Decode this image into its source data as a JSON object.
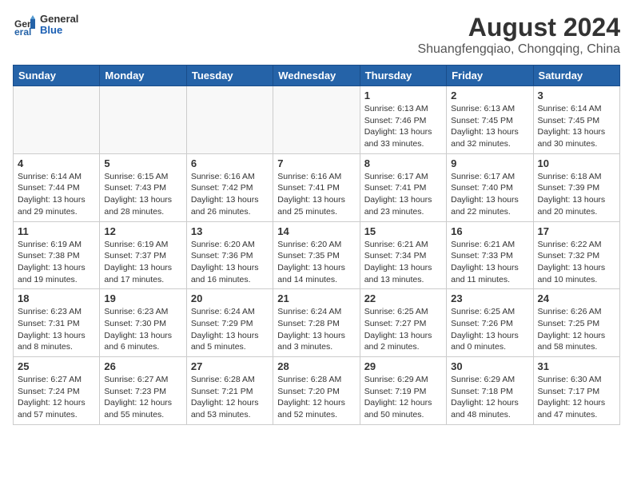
{
  "header": {
    "logo_general": "General",
    "logo_blue": "Blue",
    "title": "August 2024",
    "subtitle": "Shuangfengqiao, Chongqing, China"
  },
  "days_of_week": [
    "Sunday",
    "Monday",
    "Tuesday",
    "Wednesday",
    "Thursday",
    "Friday",
    "Saturday"
  ],
  "weeks": [
    [
      {
        "day": "",
        "info": ""
      },
      {
        "day": "",
        "info": ""
      },
      {
        "day": "",
        "info": ""
      },
      {
        "day": "",
        "info": ""
      },
      {
        "day": "1",
        "info": "Sunrise: 6:13 AM\nSunset: 7:46 PM\nDaylight: 13 hours\nand 33 minutes."
      },
      {
        "day": "2",
        "info": "Sunrise: 6:13 AM\nSunset: 7:45 PM\nDaylight: 13 hours\nand 32 minutes."
      },
      {
        "day": "3",
        "info": "Sunrise: 6:14 AM\nSunset: 7:45 PM\nDaylight: 13 hours\nand 30 minutes."
      }
    ],
    [
      {
        "day": "4",
        "info": "Sunrise: 6:14 AM\nSunset: 7:44 PM\nDaylight: 13 hours\nand 29 minutes."
      },
      {
        "day": "5",
        "info": "Sunrise: 6:15 AM\nSunset: 7:43 PM\nDaylight: 13 hours\nand 28 minutes."
      },
      {
        "day": "6",
        "info": "Sunrise: 6:16 AM\nSunset: 7:42 PM\nDaylight: 13 hours\nand 26 minutes."
      },
      {
        "day": "7",
        "info": "Sunrise: 6:16 AM\nSunset: 7:41 PM\nDaylight: 13 hours\nand 25 minutes."
      },
      {
        "day": "8",
        "info": "Sunrise: 6:17 AM\nSunset: 7:41 PM\nDaylight: 13 hours\nand 23 minutes."
      },
      {
        "day": "9",
        "info": "Sunrise: 6:17 AM\nSunset: 7:40 PM\nDaylight: 13 hours\nand 22 minutes."
      },
      {
        "day": "10",
        "info": "Sunrise: 6:18 AM\nSunset: 7:39 PM\nDaylight: 13 hours\nand 20 minutes."
      }
    ],
    [
      {
        "day": "11",
        "info": "Sunrise: 6:19 AM\nSunset: 7:38 PM\nDaylight: 13 hours\nand 19 minutes."
      },
      {
        "day": "12",
        "info": "Sunrise: 6:19 AM\nSunset: 7:37 PM\nDaylight: 13 hours\nand 17 minutes."
      },
      {
        "day": "13",
        "info": "Sunrise: 6:20 AM\nSunset: 7:36 PM\nDaylight: 13 hours\nand 16 minutes."
      },
      {
        "day": "14",
        "info": "Sunrise: 6:20 AM\nSunset: 7:35 PM\nDaylight: 13 hours\nand 14 minutes."
      },
      {
        "day": "15",
        "info": "Sunrise: 6:21 AM\nSunset: 7:34 PM\nDaylight: 13 hours\nand 13 minutes."
      },
      {
        "day": "16",
        "info": "Sunrise: 6:21 AM\nSunset: 7:33 PM\nDaylight: 13 hours\nand 11 minutes."
      },
      {
        "day": "17",
        "info": "Sunrise: 6:22 AM\nSunset: 7:32 PM\nDaylight: 13 hours\nand 10 minutes."
      }
    ],
    [
      {
        "day": "18",
        "info": "Sunrise: 6:23 AM\nSunset: 7:31 PM\nDaylight: 13 hours\nand 8 minutes."
      },
      {
        "day": "19",
        "info": "Sunrise: 6:23 AM\nSunset: 7:30 PM\nDaylight: 13 hours\nand 6 minutes."
      },
      {
        "day": "20",
        "info": "Sunrise: 6:24 AM\nSunset: 7:29 PM\nDaylight: 13 hours\nand 5 minutes."
      },
      {
        "day": "21",
        "info": "Sunrise: 6:24 AM\nSunset: 7:28 PM\nDaylight: 13 hours\nand 3 minutes."
      },
      {
        "day": "22",
        "info": "Sunrise: 6:25 AM\nSunset: 7:27 PM\nDaylight: 13 hours\nand 2 minutes."
      },
      {
        "day": "23",
        "info": "Sunrise: 6:25 AM\nSunset: 7:26 PM\nDaylight: 13 hours\nand 0 minutes."
      },
      {
        "day": "24",
        "info": "Sunrise: 6:26 AM\nSunset: 7:25 PM\nDaylight: 12 hours\nand 58 minutes."
      }
    ],
    [
      {
        "day": "25",
        "info": "Sunrise: 6:27 AM\nSunset: 7:24 PM\nDaylight: 12 hours\nand 57 minutes."
      },
      {
        "day": "26",
        "info": "Sunrise: 6:27 AM\nSunset: 7:23 PM\nDaylight: 12 hours\nand 55 minutes."
      },
      {
        "day": "27",
        "info": "Sunrise: 6:28 AM\nSunset: 7:21 PM\nDaylight: 12 hours\nand 53 minutes."
      },
      {
        "day": "28",
        "info": "Sunrise: 6:28 AM\nSunset: 7:20 PM\nDaylight: 12 hours\nand 52 minutes."
      },
      {
        "day": "29",
        "info": "Sunrise: 6:29 AM\nSunset: 7:19 PM\nDaylight: 12 hours\nand 50 minutes."
      },
      {
        "day": "30",
        "info": "Sunrise: 6:29 AM\nSunset: 7:18 PM\nDaylight: 12 hours\nand 48 minutes."
      },
      {
        "day": "31",
        "info": "Sunrise: 6:30 AM\nSunset: 7:17 PM\nDaylight: 12 hours\nand 47 minutes."
      }
    ]
  ]
}
